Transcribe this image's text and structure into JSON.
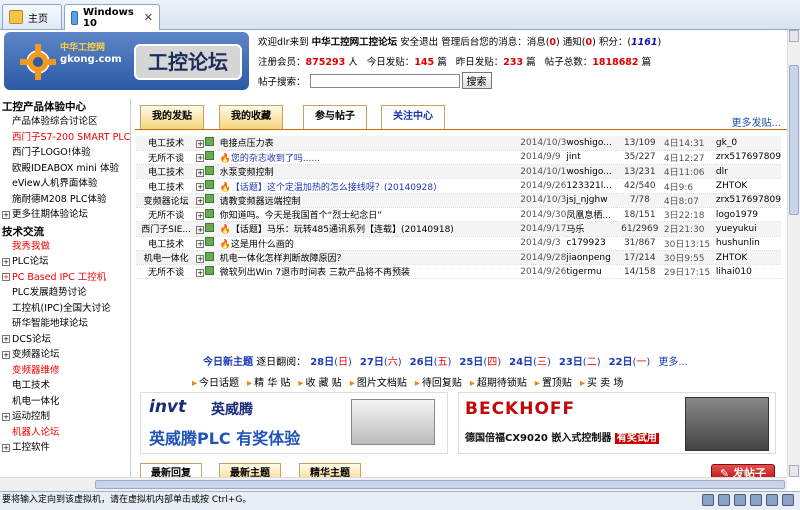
{
  "vm_tabs": [
    {
      "label": "主页"
    },
    {
      "label": "Windows 10"
    }
  ],
  "header": {
    "logo_text": "中华工控网",
    "logo_sub": "gkong.com",
    "logo_title": "工控论坛",
    "welcome": "欢迎dlr来到",
    "site_name": "中华工控网工控论坛",
    "safe_exit": "安全退出",
    "manage_msg": "管理后台您的消息：消息(",
    "msg_count": "0",
    "notice_label": ")  通知(",
    "notice_count": "0",
    "points_label": ")  积分：(",
    "points": "1161",
    "points_end": ")",
    "members_label": "注册会员：",
    "members": "875293",
    "members_unit": "人",
    "today_label": "今日发贴：",
    "today": "145",
    "today_unit": "篇",
    "yesterday_label": "昨日发贴：",
    "yesterday": "233",
    "yesterday_unit": "篇",
    "total_label": "帖子总数：",
    "total": "1818682",
    "total_unit": "篇",
    "search_label": "帖子搜索：",
    "search_button": "搜索"
  },
  "sidebar": {
    "sections": [
      {
        "heading": "工控产品体验中心",
        "items": [
          {
            "label": "产品体验综合讨论区",
            "red": false
          },
          {
            "label": "西门子S7-200 SMART PLC体验",
            "red": true
          },
          {
            "label": "西门子LOGO!体验",
            "red": false
          },
          {
            "label": "欧殿IDEABOX mini 体验",
            "red": false
          },
          {
            "label": "eView人机界面体验",
            "red": false
          },
          {
            "label": "施耐德M208 PLC体验",
            "red": false
          },
          {
            "label": "更多往期体验论坛",
            "red": false,
            "plus": true
          }
        ]
      },
      {
        "heading": "技术交流",
        "items": [
          {
            "label": "我秀我做",
            "red": true
          },
          {
            "label": "PLC论坛",
            "red": false,
            "plus": true
          },
          {
            "label": "PC Based IPC 工控机",
            "red": true,
            "plus": true
          },
          {
            "label": "PLC发展趋势讨论",
            "red": false
          },
          {
            "label": "工控机(IPC)全国大讨论",
            "red": false
          },
          {
            "label": "研华智能地球论坛",
            "red": false
          },
          {
            "label": "DCS论坛",
            "red": false,
            "plus": true
          },
          {
            "label": "变频器论坛",
            "red": false,
            "plus": true
          },
          {
            "label": "变频器维修",
            "red": true
          },
          {
            "label": "电工技术",
            "red": false
          },
          {
            "label": "机电一体化",
            "red": false
          },
          {
            "label": "运动控制",
            "red": false,
            "plus": true
          },
          {
            "label": "机器人论坛",
            "red": true
          },
          {
            "label": "工控软件",
            "red": false,
            "plus": true
          }
        ]
      }
    ]
  },
  "main": {
    "tabs": [
      {
        "label": "我的发贴"
      },
      {
        "label": "我的收藏"
      },
      {
        "label": "参与帖子"
      },
      {
        "label": "关注中心"
      }
    ],
    "more_posts": "更多发贴...",
    "posts": [
      {
        "cat": "电工技术",
        "title": "电接点压力表",
        "hot": false,
        "date": "2014/10/3",
        "author": "woshigo...",
        "replies": "13/109",
        "last": "4日14:31",
        "last_user": "gk_0",
        "color": "black"
      },
      {
        "cat": "无所不谈",
        "title": "您的杂志收到了吗......",
        "hot": true,
        "date": "2014/9/9",
        "author": "jint",
        "replies": "35/227",
        "last": "4日12:27",
        "last_user": "zrx517697809",
        "color": "blue"
      },
      {
        "cat": "电工技术",
        "title": "水泵变频控制",
        "hot": false,
        "date": "2014/10/1",
        "author": "woshigo...",
        "replies": "13/231",
        "last": "4日11:06",
        "last_user": "dlr",
        "color": "black"
      },
      {
        "cat": "电工技术",
        "title": "【话题】这个定温加热的怎么接线呀？(20140928)",
        "hot": true,
        "date": "2014/9/26",
        "author": "123321l...",
        "replies": "42/540",
        "last": "4日9:6",
        "last_user": "ZHTOK",
        "color": "blue"
      },
      {
        "cat": "变频器论坛",
        "title": "请教变频器远端控制",
        "hot": false,
        "date": "2014/10/3",
        "author": "jsj_njghw",
        "replies": "7/78",
        "last": "4日8:07",
        "last_user": "zrx517697809",
        "color": "black"
      },
      {
        "cat": "无所不谈",
        "title": "你知道吗。今天是我国首个“烈士纪念日”",
        "hot": false,
        "date": "2014/9/30",
        "author": "凤凰息栖...",
        "replies": "18/151",
        "last": "3日22:18",
        "last_user": "logo1979",
        "color": "black"
      },
      {
        "cat": "西门子SIE...",
        "title": "【话题】马乐：玩转485通讯系列【连载】(20140918)",
        "hot": true,
        "date": "2014/9/17",
        "author": "马乐",
        "replies": "61/2969",
        "last": "2日21:30",
        "last_user": "yueyukui",
        "color": "black"
      },
      {
        "cat": "电工技术",
        "title": "这是用什么画的",
        "hot": true,
        "date": "2014/9/3",
        "author": "c179923",
        "replies": "31/867",
        "last": "30日13:15",
        "last_user": "hushunlin",
        "color": "black"
      },
      {
        "cat": "机电一体化",
        "title": "机电一体化怎样判断故障原因？",
        "hot": false,
        "date": "2014/9/28",
        "author": "jiaonpeng",
        "replies": "17/214",
        "last": "30日9:55",
        "last_user": "ZHTOK",
        "color": "black"
      },
      {
        "cat": "无所不谈",
        "title": "微软列出Win 7退市时间表 三款产品将不再预装",
        "hot": false,
        "date": "2014/9/26",
        "author": "tigermu",
        "replies": "14/158",
        "last": "29日17:15",
        "last_user": "lihai010",
        "color": "black"
      }
    ],
    "datenav": {
      "label": "今日新主题",
      "back": "逐日翻阅：",
      "days": [
        {
          "d": "28日",
          "w": "日"
        },
        {
          "d": "27日",
          "w": "六"
        },
        {
          "d": "26日",
          "w": "五"
        },
        {
          "d": "25日",
          "w": "四"
        },
        {
          "d": "24日",
          "w": "三"
        },
        {
          "d": "23日",
          "w": "二"
        },
        {
          "d": "22日",
          "w": "一"
        }
      ],
      "more": "更多..."
    },
    "quicknav": [
      "今日话题",
      "精 华 贴",
      "收 藏 贴",
      "图片文档贴",
      "待回复贴",
      "超期待锁贴",
      "置顶贴",
      "买 卖 场"
    ],
    "ad1": {
      "brand": "invt",
      "brand_cn": "英威腾",
      "slogan": "英威腾PLC 有奖体验"
    },
    "ad2": {
      "brand": "BECKHOFF",
      "slogan_a": "德国倍福CX9020 嵌入式控制器",
      "slogan_b": "有奖试用"
    },
    "tabs2": [
      {
        "label": "最新回复"
      },
      {
        "label": "最新主题"
      },
      {
        "label": "精华主题"
      }
    ],
    "post_button": "发帖子"
  },
  "statusbar": {
    "text": "要将输入定向到该虚拟机，请在虚拟机内部单击或按 Ctrl+G。"
  }
}
